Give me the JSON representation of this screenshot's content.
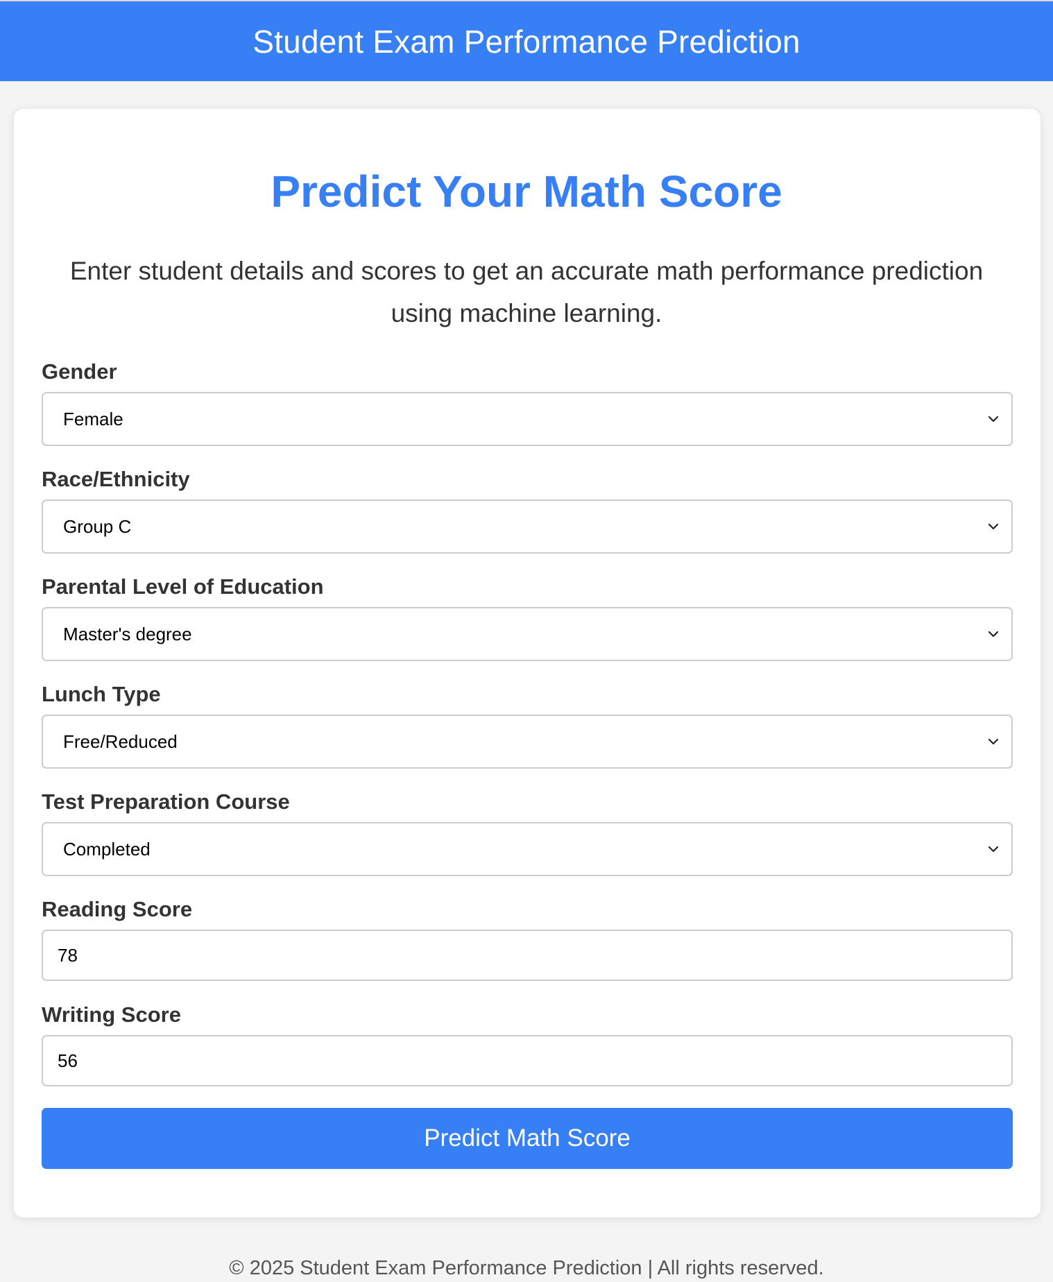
{
  "header": {
    "title": "Student Exam Performance Prediction"
  },
  "card": {
    "title": "Predict Your Math Score",
    "description": "Enter student details and scores to get an accurate math performance prediction using machine learning."
  },
  "form": {
    "gender": {
      "label": "Gender",
      "value": "Female"
    },
    "race": {
      "label": "Race/Ethnicity",
      "value": "Group C"
    },
    "parental_education": {
      "label": "Parental Level of Education",
      "value": "Master's degree"
    },
    "lunch": {
      "label": "Lunch Type",
      "value": "Free/Reduced"
    },
    "test_prep": {
      "label": "Test Preparation Course",
      "value": "Completed"
    },
    "reading_score": {
      "label": "Reading Score",
      "value": "78"
    },
    "writing_score": {
      "label": "Writing Score",
      "value": "56"
    },
    "submit_label": "Predict Math Score"
  },
  "footer": {
    "text": "© 2025 Student Exam Performance Prediction | All rights reserved."
  },
  "colors": {
    "accent": "#367ff5",
    "background": "#f4f4f4",
    "card": "#ffffff",
    "text": "#333333"
  },
  "icons": {
    "select_arrow": "chevron-down-icon"
  }
}
